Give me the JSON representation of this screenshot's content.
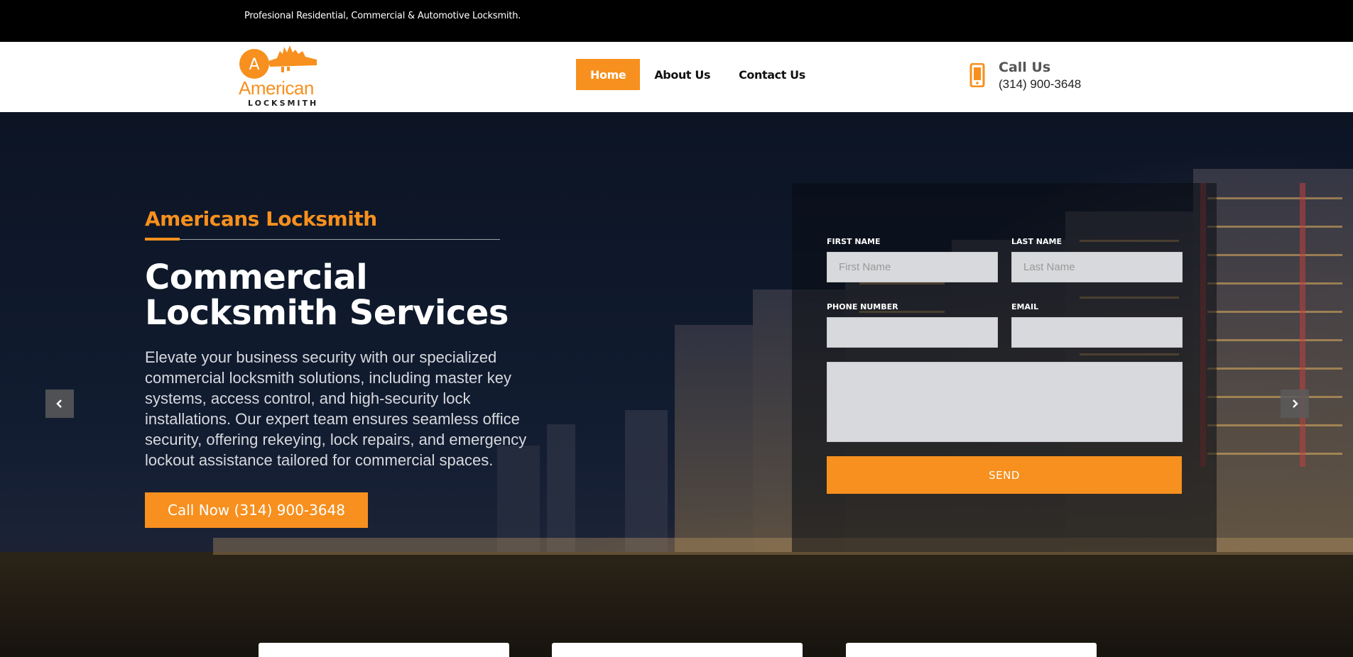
{
  "topbar": {
    "tagline": "Profesional Residential, Commercial & Automotive Locksmith."
  },
  "logo": {
    "badge_letter": "A",
    "word1": "American",
    "word2": "LOCKSMITH"
  },
  "nav": {
    "items": [
      {
        "label": "Home",
        "active": true
      },
      {
        "label": "About Us",
        "active": false
      },
      {
        "label": "Contact Us",
        "active": false
      }
    ]
  },
  "callus": {
    "label": "Call Us",
    "number": "(314) 900-3648"
  },
  "hero": {
    "kicker": "Americans Locksmith",
    "headline_line1": "Commercial",
    "headline_line2": "Locksmith Services",
    "description": "Elevate your business security with our specialized commercial locksmith solutions, including master key systems, access control, and high-security lock installations. Our expert team ensures seamless office security, offering rekeying, lock repairs, and emergency lockout assistance tailored for commercial spaces.",
    "cta_label": "Call Now (314) 900-3648"
  },
  "form": {
    "first_name_label": "FIRST NAME",
    "first_name_placeholder": "First Name",
    "last_name_label": "LAST NAME",
    "last_name_placeholder": "Last Name",
    "phone_label": "PHONE NUMBER",
    "email_label": "EMAIL",
    "send_label": "SEND"
  },
  "colors": {
    "accent": "#f7901e",
    "topbar": "#000000"
  },
  "icons": {
    "phone": "mobile-phone-icon",
    "prev": "chevron-left-icon",
    "next": "chevron-right-icon"
  }
}
